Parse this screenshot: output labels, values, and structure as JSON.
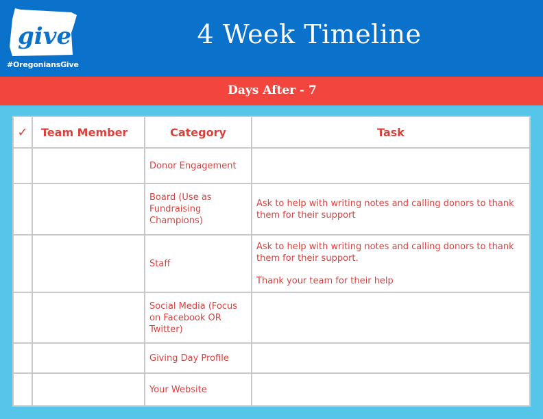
{
  "header": {
    "logo_text": "give",
    "hashtag": "#OregoniansGive",
    "title": "4 Week Timeline",
    "colors": {
      "header_bg": "#0b72cc",
      "band_bg": "#f2453d",
      "page_bg": "#55c6ea",
      "text_accent": "#d9413d"
    }
  },
  "band": {
    "label": "Days After - 7"
  },
  "table": {
    "headers": {
      "check": "✓",
      "team_member": "Team Member",
      "category": "Category",
      "task": "Task"
    },
    "rows": [
      {
        "category": "Donor Engagement",
        "task": "",
        "task2": ""
      },
      {
        "category": "Board (Use as Fundraising Champions)",
        "task": "Ask to help with writing notes and calling donors to thank them for their support",
        "task2": ""
      },
      {
        "category": "Staff",
        "task": "Ask to help with writing notes and calling donors to thank them for their support.",
        "task2": "Thank your team for their help"
      },
      {
        "category": "Social Media (Focus on Facebook OR Twitter)",
        "task": "",
        "task2": ""
      },
      {
        "category": "Giving Day Profile",
        "task": "",
        "task2": ""
      },
      {
        "category": "Your Website",
        "task": "",
        "task2": ""
      }
    ]
  }
}
